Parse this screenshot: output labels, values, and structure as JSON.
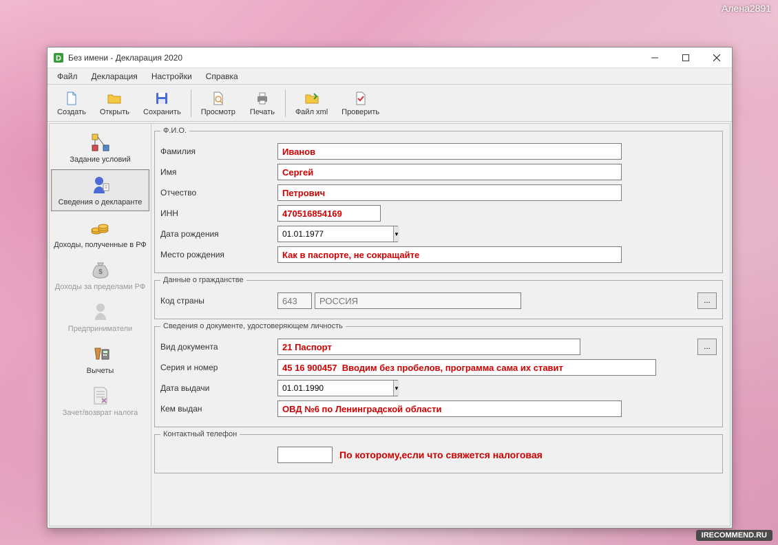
{
  "watermarks": {
    "top_right": "Алена2891",
    "bottom_right": "IRECOMMEND.RU"
  },
  "window": {
    "title": "Без имени - Декларация 2020"
  },
  "menubar": [
    "Файл",
    "Декларация",
    "Настройки",
    "Справка"
  ],
  "toolbar": {
    "create": "Создать",
    "open": "Открыть",
    "save": "Сохранить",
    "preview": "Просмотр",
    "print": "Печать",
    "xml": "Файл xml",
    "check": "Проверить"
  },
  "sidebar": {
    "items": [
      {
        "label": "Задание условий"
      },
      {
        "label": "Сведения о декларанте"
      },
      {
        "label": "Доходы, полученные в РФ"
      },
      {
        "label": "Доходы за пределами РФ"
      },
      {
        "label": "Предприниматели"
      },
      {
        "label": "Вычеты"
      },
      {
        "label": "Зачет/возврат налога"
      }
    ]
  },
  "form": {
    "fio_legend": "Ф.И.О.",
    "surname_label": "Фамилия",
    "surname_value": "Иванов",
    "name_label": "Имя",
    "name_value": "Сергей",
    "patronymic_label": "Отчество",
    "patronymic_value": "Петрович",
    "inn_label": "ИНН",
    "inn_value": "470516854169",
    "dob_label": "Дата рождения",
    "dob_value": "01.01.1977",
    "pob_label": "Место рождения",
    "pob_value": "Как в паспорте, не сокращайте",
    "citizenship_legend": "Данные о гражданстве",
    "country_code_label": "Код страны",
    "country_code": "643",
    "country_name": "РОССИЯ",
    "doc_legend": "Сведения о документе, удостоверяющем личность",
    "doc_type_label": "Вид документа",
    "doc_type_value": "21 Паспорт",
    "series_label": "Серия и номер",
    "series_value": "45 16 900457  Вводим без пробелов, программа сама их ставит",
    "issue_date_label": "Дата выдачи",
    "issue_date_value": "01.01.1990",
    "issuer_label": "Кем выдан",
    "issuer_value": "ОВД №6 по Ленинградской области",
    "phone_legend": "Контактный телефон",
    "phone_annotation": "По которому,если что свяжется налоговая",
    "ellipsis": "..."
  }
}
